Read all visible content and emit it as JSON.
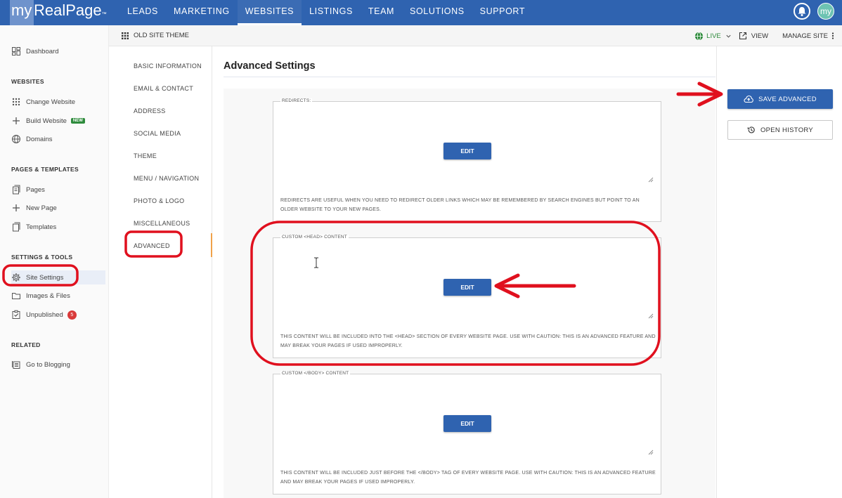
{
  "app": {
    "logo_my": "my",
    "logo_rest": "RealPage",
    "logo_tm": "™",
    "avatar": "my"
  },
  "nav": [
    {
      "label": "LEADS"
    },
    {
      "label": "MARKETING"
    },
    {
      "label": "WEBSITES",
      "active": true
    },
    {
      "label": "LISTINGS"
    },
    {
      "label": "TEAM"
    },
    {
      "label": "SOLUTIONS"
    },
    {
      "label": "SUPPORT"
    }
  ],
  "sidebar": {
    "dashboard": "Dashboard",
    "sections": {
      "websites": "WEBSITES",
      "pages": "PAGES & TEMPLATES",
      "settings": "SETTINGS & TOOLS",
      "related": "RELATED"
    },
    "items": {
      "change_website": "Change Website",
      "build_website": "Build Website",
      "build_badge": "NEW",
      "domains": "Domains",
      "pages": "Pages",
      "new_page": "New Page",
      "templates": "Templates",
      "site_settings": "Site Settings",
      "images_files": "Images & Files",
      "unpublished": "Unpublished",
      "unpublished_count": "5",
      "go_to_blogging": "Go to Blogging"
    }
  },
  "subbar": {
    "theme": "OLD SITE THEME",
    "live": "LIVE",
    "view": "VIEW",
    "manage_site": "MANAGE SITE"
  },
  "settings_menu": [
    "BASIC INFORMATION",
    "EMAIL & CONTACT",
    "ADDRESS",
    "SOCIAL MEDIA",
    "THEME",
    "MENU / NAVIGATION",
    "PHOTO & LOGO",
    "MISCELLANEOUS",
    "ADVANCED"
  ],
  "main": {
    "title": "Advanced Settings",
    "edit_label": "EDIT",
    "fields": [
      {
        "legend": "REDIRECTS:",
        "help": "REDIRECTS ARE USEFUL WHEN YOU NEED TO REDIRECT OLDER LINKS WHICH MAY BE REMEMBERED BY SEARCH ENGINES BUT POINT TO AN OLDER WEBSITE TO YOUR NEW PAGES."
      },
      {
        "legend": "CUSTOM <HEAD> CONTENT",
        "help": "THIS CONTENT WILL BE INCLUDED INTO THE <HEAD> SECTION OF EVERY WEBSITE PAGE. USE WITH CAUTION: THIS IS AN ADVANCED FEATURE AND MAY BREAK YOUR PAGES IF USED IMPROPERLY."
      },
      {
        "legend": "CUSTOM </BODY> CONTENT",
        "help": "THIS CONTENT WILL BE INCLUDED JUST BEFORE THE </BODY> TAG OF EVERY WEBSITE PAGE. USE WITH CAUTION: THIS IS AN ADVANCED FEATURE AND MAY BREAK YOUR PAGES IF USED IMPROPERLY."
      }
    ]
  },
  "actions": {
    "save": "SAVE ADVANCED",
    "history": "OPEN HISTORY"
  },
  "colors": {
    "brand": "#2f63b0",
    "annotation": "#e0101e"
  }
}
